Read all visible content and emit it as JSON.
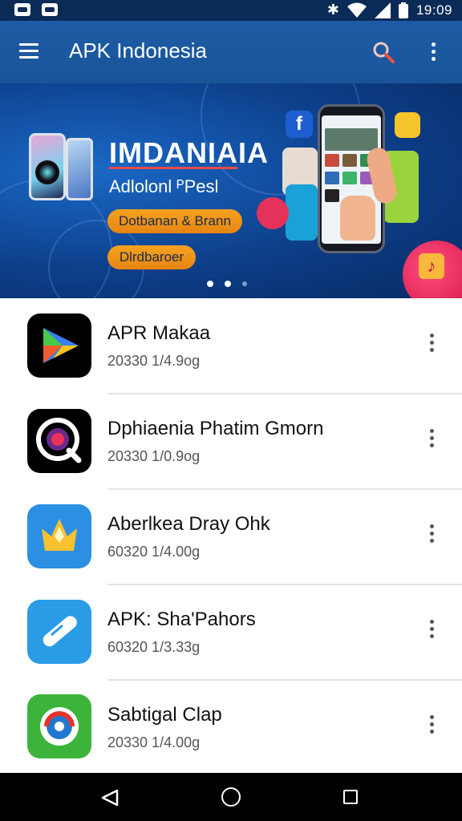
{
  "status_bar": {
    "time": "19:09",
    "icons": [
      "notification-icon",
      "image-notification-icon",
      "bluetooth-icon",
      "wifi-icon",
      "signal-icon",
      "battery-icon"
    ]
  },
  "app_bar": {
    "title": "APK Indonesia",
    "icons": [
      "menu-icon",
      "search-icon",
      "more-vert-icon"
    ]
  },
  "banner": {
    "heading": "IMDANIAIA",
    "subheading": "Adlolonl ᴾPesl",
    "button_primary": "Dotbanan & Brann",
    "button_secondary": "Dlrdbaroer",
    "pagination": {
      "total": 3,
      "active": 1
    },
    "colors": {
      "background": "#0d3f8a",
      "accent": "#f7a21f",
      "divider": "#e64b4b"
    }
  },
  "apps": [
    {
      "name": "APR Makaa",
      "meta": "20330 1/4.9og",
      "icon": "play-triangle-icon",
      "color": "#000000"
    },
    {
      "name": "Dphiaenia Phatim Gmorn",
      "meta": "20330 1/0.9og",
      "icon": "camera-lens-icon",
      "color": "#000000"
    },
    {
      "name": "Aberlkea Dray Ohk",
      "meta": "60320 1/4.00g",
      "icon": "crown-icon",
      "color": "#2b8fe3"
    },
    {
      "name": "APK: Sha'Pahors",
      "meta": "60320 1/3.33g",
      "icon": "pen-icon",
      "color": "#2a9ce6"
    },
    {
      "name": "Sabtigal Clap",
      "meta": "20330 1/4.00g",
      "icon": "swirl-icon",
      "color": "#3cb43c"
    }
  ],
  "nav_bar": {
    "icons": [
      "back-icon",
      "home-icon",
      "recents-icon"
    ]
  }
}
